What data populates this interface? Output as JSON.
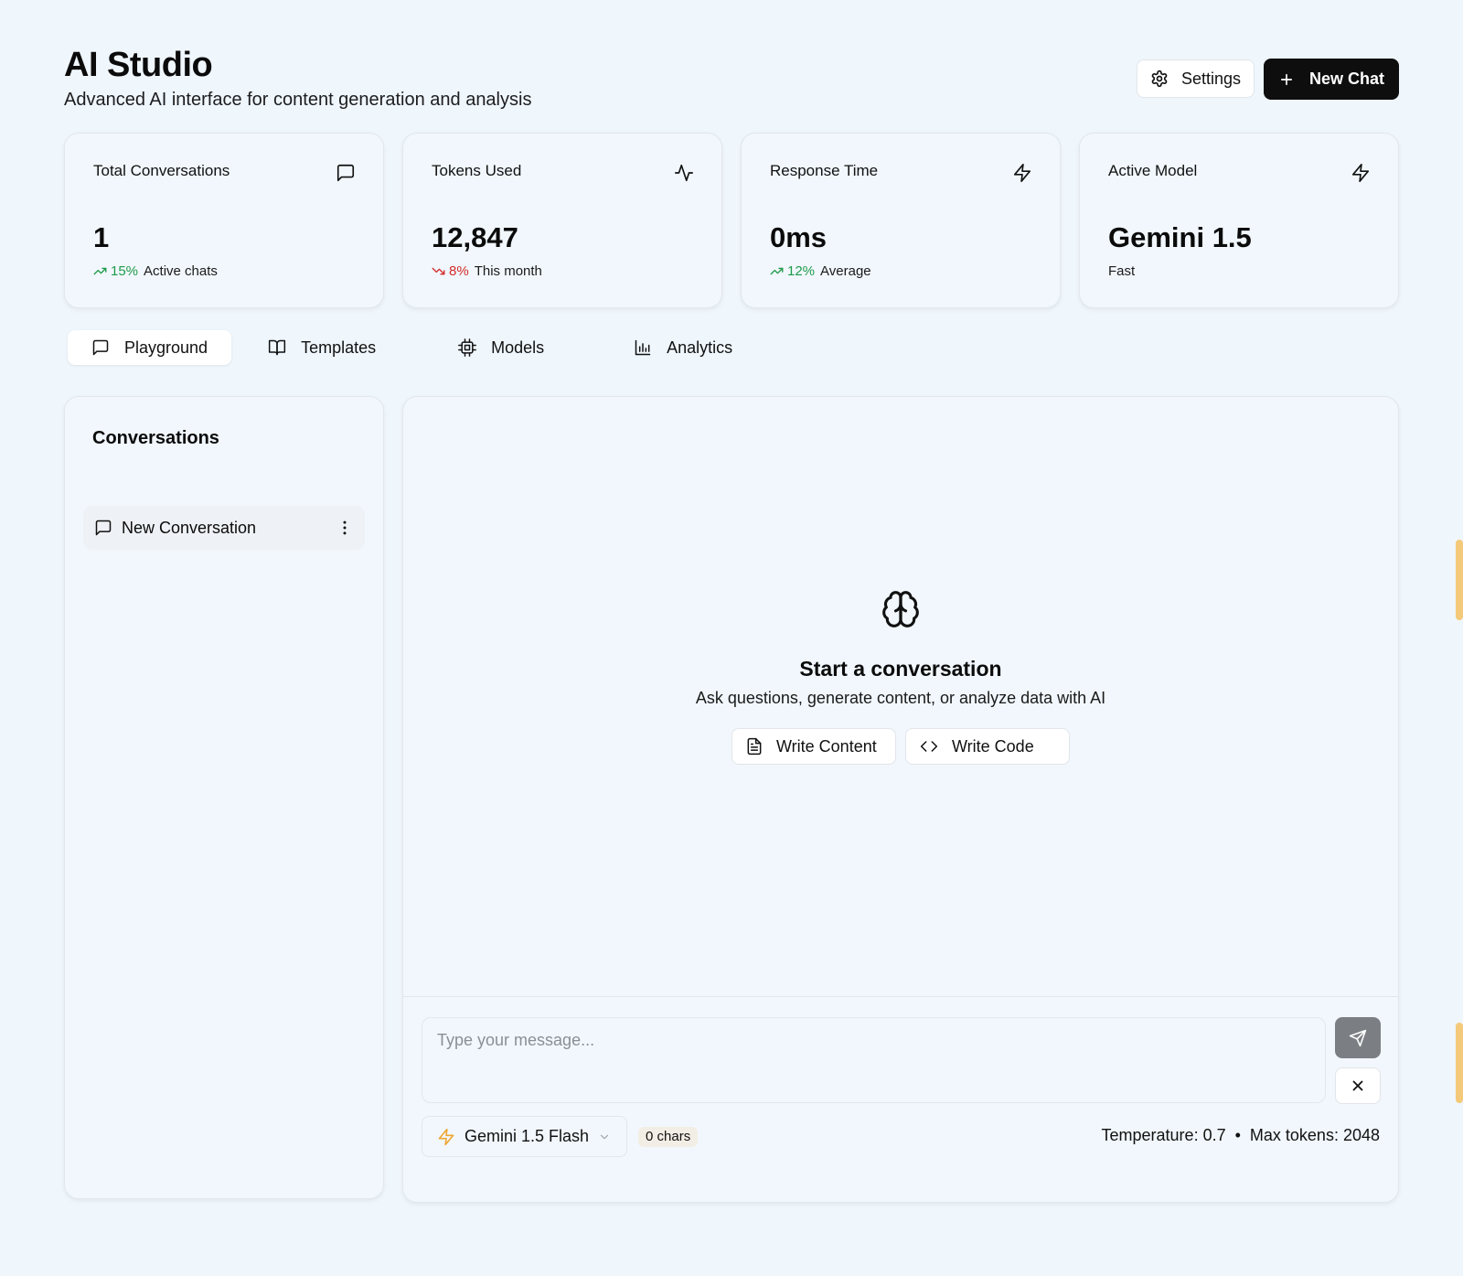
{
  "header": {
    "title": "AI Studio",
    "subtitle": "Advanced AI interface for content generation and analysis",
    "settings_label": "Settings",
    "new_chat_label": "New Chat"
  },
  "stats": [
    {
      "label": "Total Conversations",
      "icon": "message-square-icon",
      "value": "1",
      "trend": "15%",
      "trend_dir": "up",
      "caption": "Active chats"
    },
    {
      "label": "Tokens Used",
      "icon": "activity-icon",
      "value": "12,847",
      "trend": "8%",
      "trend_dir": "down",
      "caption": "This month"
    },
    {
      "label": "Response Time",
      "icon": "zap-icon",
      "value": "0ms",
      "trend": "12%",
      "trend_dir": "up",
      "caption": "Average"
    },
    {
      "label": "Active Model",
      "icon": "zap-icon",
      "value": "Gemini 1.5",
      "trend": "",
      "trend_dir": "",
      "caption": "Fast"
    }
  ],
  "tabs": [
    {
      "label": "Playground",
      "icon": "message-square-icon",
      "active": true
    },
    {
      "label": "Templates",
      "icon": "book-open-icon",
      "active": false
    },
    {
      "label": "Models",
      "icon": "cpu-icon",
      "active": false
    },
    {
      "label": "Analytics",
      "icon": "bar-chart-icon",
      "active": false
    }
  ],
  "conversations": {
    "title": "Conversations",
    "items": [
      {
        "label": "New Conversation"
      }
    ]
  },
  "chat": {
    "empty_title": "Start a conversation",
    "empty_desc": "Ask questions, generate content, or analyze data with AI",
    "quick_actions": [
      {
        "label": "Write Content",
        "icon": "file-text-icon"
      },
      {
        "label": "Write Code",
        "icon": "code-icon"
      }
    ],
    "input_placeholder": "Type your message...",
    "model": "Gemini 1.5 Flash",
    "char_count": "0 chars",
    "temperature": "Temperature: 0.7",
    "separator": "•",
    "max_tokens": "Max tokens: 2048"
  },
  "colors": {
    "background": "#eff6fc",
    "primary": "#0e0e0e",
    "trend_up": "#1f9b4b",
    "trend_down": "#d42c2c",
    "model_accent": "#f0a531"
  }
}
